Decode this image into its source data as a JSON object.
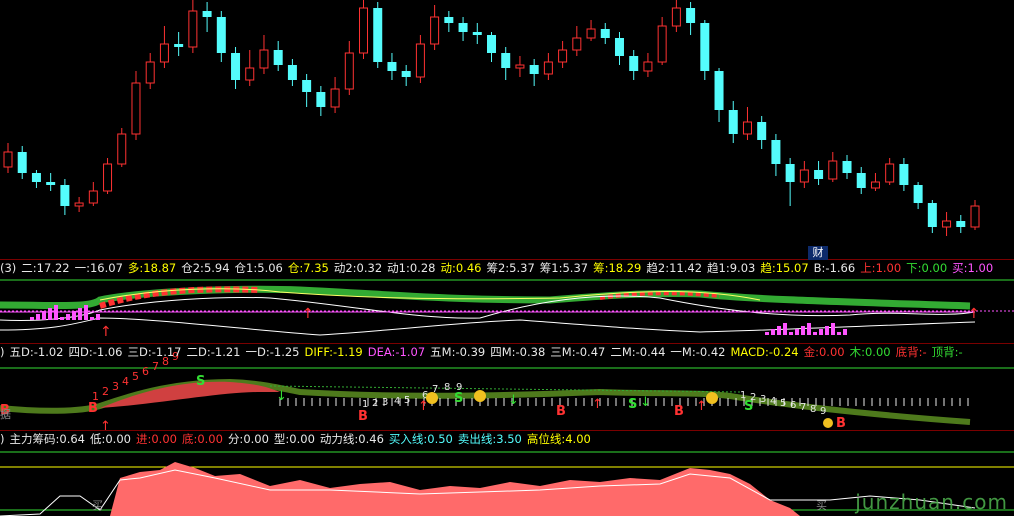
{
  "colors": {
    "up": "#ff3232",
    "down": "#54fcfc",
    "bg": "#000000",
    "label": "#e8e8e8"
  },
  "badges": {
    "cai": "财",
    "ju": "据",
    "mai1": "买",
    "mai2": "买"
  },
  "watermark": "junzhuan.com",
  "indicator1": [
    {
      "label": "二:",
      "value": "17.22",
      "color": "#e8e8e8"
    },
    {
      "label": "一:",
      "value": "16.07",
      "color": "#e8e8e8"
    },
    {
      "label": "多:",
      "value": "18.87",
      "color": "#ffff00"
    },
    {
      "label": "仓2:",
      "value": "5.94",
      "color": "#e8e8e8"
    },
    {
      "label": "仓1:",
      "value": "5.06",
      "color": "#e8e8e8"
    },
    {
      "label": "仓:",
      "value": "7.35",
      "color": "#ffff00"
    },
    {
      "label": "动2:",
      "value": "0.32",
      "color": "#e8e8e8"
    },
    {
      "label": "动1:",
      "value": "0.28",
      "color": "#e8e8e8"
    },
    {
      "label": "动:",
      "value": "0.46",
      "color": "#ffff00"
    },
    {
      "label": "筹2:",
      "value": "5.37",
      "color": "#e8e8e8"
    },
    {
      "label": "筹1:",
      "value": "5.37",
      "color": "#e8e8e8"
    },
    {
      "label": "筹:",
      "value": "18.29",
      "color": "#ffff00"
    },
    {
      "label": "趋2:",
      "value": "11.42",
      "color": "#e8e8e8"
    },
    {
      "label": "趋1:",
      "value": "9.03",
      "color": "#e8e8e8"
    },
    {
      "label": "趋:",
      "value": "15.07",
      "color": "#ffff00"
    },
    {
      "label": "B:",
      "value": "-1.66",
      "color": "#e8e8e8"
    },
    {
      "label": "上:",
      "value": "1.00",
      "color": "#ff3232"
    },
    {
      "label": "下:",
      "value": "0.00",
      "color": "#33dd33"
    },
    {
      "label": "买:",
      "value": "1.00",
      "color": "#ff55ff"
    }
  ],
  "indicator1_prefix": "(3)",
  "indicator2": [
    {
      "label": "五D:",
      "value": "-1.02",
      "color": "#e8e8e8"
    },
    {
      "label": "四D:",
      "value": "-1.06",
      "color": "#e8e8e8"
    },
    {
      "label": "三D:",
      "value": "-1.17",
      "color": "#e8e8e8"
    },
    {
      "label": "二D:",
      "value": "-1.21",
      "color": "#e8e8e8"
    },
    {
      "label": "一D:",
      "value": "-1.25",
      "color": "#e8e8e8"
    },
    {
      "label": "DIFF:",
      "value": "-1.19",
      "color": "#ffff00"
    },
    {
      "label": "DEA:",
      "value": "-1.07",
      "color": "#ff55ff"
    },
    {
      "label": "五M:",
      "value": "-0.39",
      "color": "#e8e8e8"
    },
    {
      "label": "四M:",
      "value": "-0.38",
      "color": "#e8e8e8"
    },
    {
      "label": "三M:",
      "value": "-0.47",
      "color": "#e8e8e8"
    },
    {
      "label": "二M:",
      "value": "-0.44",
      "color": "#e8e8e8"
    },
    {
      "label": "一M:",
      "value": "-0.42",
      "color": "#e8e8e8"
    },
    {
      "label": "MACD:",
      "value": "-0.24",
      "color": "#ffff00"
    },
    {
      "label": "金:",
      "value": "0.00",
      "color": "#ff3232"
    },
    {
      "label": "木:",
      "value": "0.00",
      "color": "#33dd33"
    },
    {
      "label": "底背:",
      "value": "-",
      "color": "#ff3232"
    },
    {
      "label": "顶背:",
      "value": "-",
      "color": "#33dd33"
    }
  ],
  "indicator2_prefix": ")",
  "indicator3": [
    {
      "label": "主力筹码:",
      "value": "0.64",
      "color": "#e8e8e8"
    },
    {
      "label": "低:",
      "value": "0.00",
      "color": "#e8e8e8"
    },
    {
      "label": "进:",
      "value": "0.00",
      "color": "#ff3232"
    },
    {
      "label": "底:",
      "value": "0.00",
      "color": "#ff3232"
    },
    {
      "label": "分:",
      "value": "0.00",
      "color": "#e8e8e8"
    },
    {
      "label": "型:",
      "value": "0.00",
      "color": "#e8e8e8"
    },
    {
      "label": "动力线:",
      "value": "0.46",
      "color": "#e8e8e8"
    },
    {
      "label": "买入线:",
      "value": "0.50",
      "color": "#54fcfc"
    },
    {
      "label": "卖出线:",
      "value": "3.50",
      "color": "#54fcfc"
    },
    {
      "label": "高位线:",
      "value": "4.00",
      "color": "#ffff00"
    }
  ],
  "indicator3_prefix": ")",
  "signals": {
    "B": "B",
    "S": "S",
    "counts_up": [
      "1",
      "2",
      "3",
      "4",
      "5",
      "6",
      "7",
      "8",
      "9"
    ],
    "counts_mid": [
      "1",
      "2",
      "3",
      "4",
      "5",
      "6",
      "7",
      "8",
      "9"
    ],
    "counts_down": [
      "1",
      "2",
      "3",
      "4",
      "5",
      "6",
      "7",
      "8",
      "9"
    ]
  },
  "candles": [
    {
      "o": 16.1,
      "c": 16.6,
      "h": 16.9,
      "l": 15.9
    },
    {
      "o": 16.6,
      "c": 15.9,
      "h": 16.8,
      "l": 15.7
    },
    {
      "o": 15.9,
      "c": 15.6,
      "h": 16.0,
      "l": 15.4
    },
    {
      "o": 15.6,
      "c": 15.5,
      "h": 15.9,
      "l": 15.3
    },
    {
      "o": 15.5,
      "c": 14.8,
      "h": 15.7,
      "l": 14.5
    },
    {
      "o": 14.8,
      "c": 14.9,
      "h": 15.1,
      "l": 14.6
    },
    {
      "o": 14.9,
      "c": 15.3,
      "h": 15.6,
      "l": 14.8
    },
    {
      "o": 15.3,
      "c": 16.2,
      "h": 16.4,
      "l": 15.2
    },
    {
      "o": 16.2,
      "c": 17.2,
      "h": 17.4,
      "l": 16.1
    },
    {
      "o": 17.2,
      "c": 18.9,
      "h": 19.3,
      "l": 17.0
    },
    {
      "o": 18.9,
      "c": 19.6,
      "h": 19.9,
      "l": 18.7
    },
    {
      "o": 19.6,
      "c": 20.2,
      "h": 20.8,
      "l": 19.4
    },
    {
      "o": 20.2,
      "c": 20.1,
      "h": 20.6,
      "l": 19.8
    },
    {
      "o": 20.1,
      "c": 21.3,
      "h": 21.7,
      "l": 19.9
    },
    {
      "o": 21.3,
      "c": 21.1,
      "h": 21.6,
      "l": 20.6
    },
    {
      "o": 21.1,
      "c": 19.9,
      "h": 21.3,
      "l": 19.6
    },
    {
      "o": 19.9,
      "c": 19.0,
      "h": 20.1,
      "l": 18.7
    },
    {
      "o": 19.0,
      "c": 19.4,
      "h": 20.0,
      "l": 18.8
    },
    {
      "o": 19.4,
      "c": 20.0,
      "h": 20.5,
      "l": 19.2
    },
    {
      "o": 20.0,
      "c": 19.5,
      "h": 20.3,
      "l": 19.3
    },
    {
      "o": 19.5,
      "c": 19.0,
      "h": 19.7,
      "l": 18.8
    },
    {
      "o": 19.0,
      "c": 18.6,
      "h": 19.2,
      "l": 18.1
    },
    {
      "o": 18.6,
      "c": 18.1,
      "h": 18.8,
      "l": 17.8
    },
    {
      "o": 18.1,
      "c": 18.7,
      "h": 19.1,
      "l": 17.9
    },
    {
      "o": 18.7,
      "c": 19.9,
      "h": 20.3,
      "l": 18.5
    },
    {
      "o": 19.9,
      "c": 21.4,
      "h": 21.9,
      "l": 19.7
    },
    {
      "o": 21.4,
      "c": 19.6,
      "h": 21.6,
      "l": 19.4
    },
    {
      "o": 19.6,
      "c": 19.3,
      "h": 19.9,
      "l": 19.0
    },
    {
      "o": 19.3,
      "c": 19.1,
      "h": 19.5,
      "l": 18.8
    },
    {
      "o": 19.1,
      "c": 20.2,
      "h": 20.5,
      "l": 18.9
    },
    {
      "o": 20.2,
      "c": 21.1,
      "h": 21.5,
      "l": 20.0
    },
    {
      "o": 21.1,
      "c": 20.9,
      "h": 21.3,
      "l": 20.6
    },
    {
      "o": 20.9,
      "c": 20.6,
      "h": 21.1,
      "l": 20.3
    },
    {
      "o": 20.6,
      "c": 20.5,
      "h": 20.9,
      "l": 20.2
    },
    {
      "o": 20.5,
      "c": 19.9,
      "h": 20.6,
      "l": 19.6
    },
    {
      "o": 19.9,
      "c": 19.4,
      "h": 20.1,
      "l": 19.0
    },
    {
      "o": 19.4,
      "c": 19.5,
      "h": 19.8,
      "l": 19.1
    },
    {
      "o": 19.5,
      "c": 19.2,
      "h": 19.7,
      "l": 18.8
    },
    {
      "o": 19.2,
      "c": 19.6,
      "h": 19.9,
      "l": 19.0
    },
    {
      "o": 19.6,
      "c": 20.0,
      "h": 20.3,
      "l": 19.4
    },
    {
      "o": 20.0,
      "c": 20.4,
      "h": 20.8,
      "l": 19.8
    },
    {
      "o": 20.4,
      "c": 20.7,
      "h": 21.0,
      "l": 20.3
    },
    {
      "o": 20.7,
      "c": 20.4,
      "h": 20.9,
      "l": 20.2
    },
    {
      "o": 20.4,
      "c": 19.8,
      "h": 20.6,
      "l": 19.5
    },
    {
      "o": 19.8,
      "c": 19.3,
      "h": 20.0,
      "l": 19.0
    },
    {
      "o": 19.3,
      "c": 19.6,
      "h": 19.9,
      "l": 19.1
    },
    {
      "o": 19.6,
      "c": 20.8,
      "h": 21.1,
      "l": 19.5
    },
    {
      "o": 20.8,
      "c": 21.4,
      "h": 21.7,
      "l": 20.6
    },
    {
      "o": 21.4,
      "c": 20.9,
      "h": 21.6,
      "l": 20.5
    },
    {
      "o": 20.9,
      "c": 19.3,
      "h": 21.0,
      "l": 19.0
    },
    {
      "o": 19.3,
      "c": 18.0,
      "h": 19.4,
      "l": 17.6
    },
    {
      "o": 18.0,
      "c": 17.2,
      "h": 18.3,
      "l": 16.9
    },
    {
      "o": 17.2,
      "c": 17.6,
      "h": 18.1,
      "l": 17.0
    },
    {
      "o": 17.6,
      "c": 17.0,
      "h": 17.8,
      "l": 16.7
    },
    {
      "o": 17.0,
      "c": 16.2,
      "h": 17.2,
      "l": 15.8
    },
    {
      "o": 16.2,
      "c": 15.6,
      "h": 16.4,
      "l": 14.8
    },
    {
      "o": 15.6,
      "c": 16.0,
      "h": 16.3,
      "l": 15.4
    },
    {
      "o": 16.0,
      "c": 15.7,
      "h": 16.3,
      "l": 15.5
    },
    {
      "o": 15.7,
      "c": 16.3,
      "h": 16.6,
      "l": 15.6
    },
    {
      "o": 16.3,
      "c": 15.9,
      "h": 16.5,
      "l": 15.7
    },
    {
      "o": 15.9,
      "c": 15.4,
      "h": 16.1,
      "l": 15.2
    },
    {
      "o": 15.4,
      "c": 15.6,
      "h": 15.9,
      "l": 15.3
    },
    {
      "o": 15.6,
      "c": 16.2,
      "h": 16.4,
      "l": 15.5
    },
    {
      "o": 16.2,
      "c": 15.5,
      "h": 16.4,
      "l": 15.3
    },
    {
      "o": 15.5,
      "c": 14.9,
      "h": 15.6,
      "l": 14.7
    },
    {
      "o": 14.9,
      "c": 14.1,
      "h": 15.0,
      "l": 13.9
    },
    {
      "o": 14.1,
      "c": 14.3,
      "h": 14.6,
      "l": 13.8
    },
    {
      "o": 14.3,
      "c": 14.1,
      "h": 14.5,
      "l": 13.9
    },
    {
      "o": 14.1,
      "c": 14.8,
      "h": 15.0,
      "l": 14.0
    }
  ]
}
